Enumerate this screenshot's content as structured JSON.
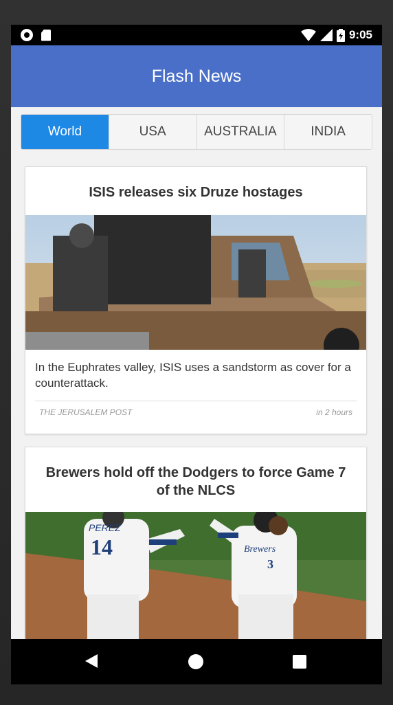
{
  "status_bar": {
    "time": "9:05",
    "icons": [
      "circle-notification-icon",
      "sd-card-icon",
      "wifi-icon",
      "cell-signal-icon",
      "battery-icon"
    ]
  },
  "app_bar": {
    "title": "Flash News",
    "color": "#4a6fc9"
  },
  "tabs": [
    {
      "label": "World",
      "active": true
    },
    {
      "label": "USA",
      "active": false
    },
    {
      "label": "AUSTRALIA",
      "active": false
    },
    {
      "label": "INDIA",
      "active": false
    }
  ],
  "accent_color": "#1e88e5",
  "articles": [
    {
      "title": "ISIS releases six Druze hostages",
      "description": "In the Euphrates valley, ISIS uses a sandstorm as cover for a counterattack.",
      "source": "THE JERUSALEM POST",
      "time": "in 2 hours"
    },
    {
      "title": "Brewers hold off the Dodgers to force Game 7 of the NLCS",
      "image_text": {
        "left_player_name": "PEREZ",
        "left_player_number": "14",
        "right_player_jersey": "Brewers",
        "right_player_number": "3"
      }
    }
  ],
  "nav_bar": {
    "icons": [
      "back-icon",
      "home-icon",
      "recents-icon"
    ]
  }
}
